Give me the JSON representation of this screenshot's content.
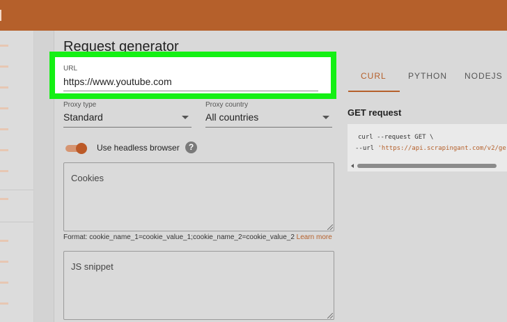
{
  "page": {
    "title": "Request generator"
  },
  "url_field": {
    "label": "URL",
    "value": "https://www.youtube.com"
  },
  "proxy_type": {
    "label": "Proxy type",
    "value": "Standard"
  },
  "proxy_country": {
    "label": "Proxy country",
    "value": "All countries"
  },
  "headless": {
    "label": "Use headless browser",
    "help_glyph": "?",
    "enabled": true
  },
  "cookies": {
    "placeholder": "Cookies",
    "hint": "Format: cookie_name_1=cookie_value_1;cookie_name_2=cookie_value_2",
    "learn_more": "Learn more"
  },
  "js_snippet": {
    "placeholder": "JS snippet"
  },
  "tabs": [
    {
      "label": "CURL",
      "active": true
    },
    {
      "label": "PYTHON",
      "active": false
    },
    {
      "label": "NODEJS",
      "active": false
    }
  ],
  "output": {
    "title": "GET request",
    "code_line_1": "curl --request GET \\",
    "code_line_2_prefix": "--url ",
    "code_line_2_string": "'https://api.scrapingant.com/v2/ge"
  },
  "colors": {
    "brand": "#b5602b",
    "highlight": "#14f014"
  },
  "icons": {
    "help": "help-icon",
    "dropdown": "chevron-down-icon",
    "scroll-left": "arrow-left-icon"
  }
}
